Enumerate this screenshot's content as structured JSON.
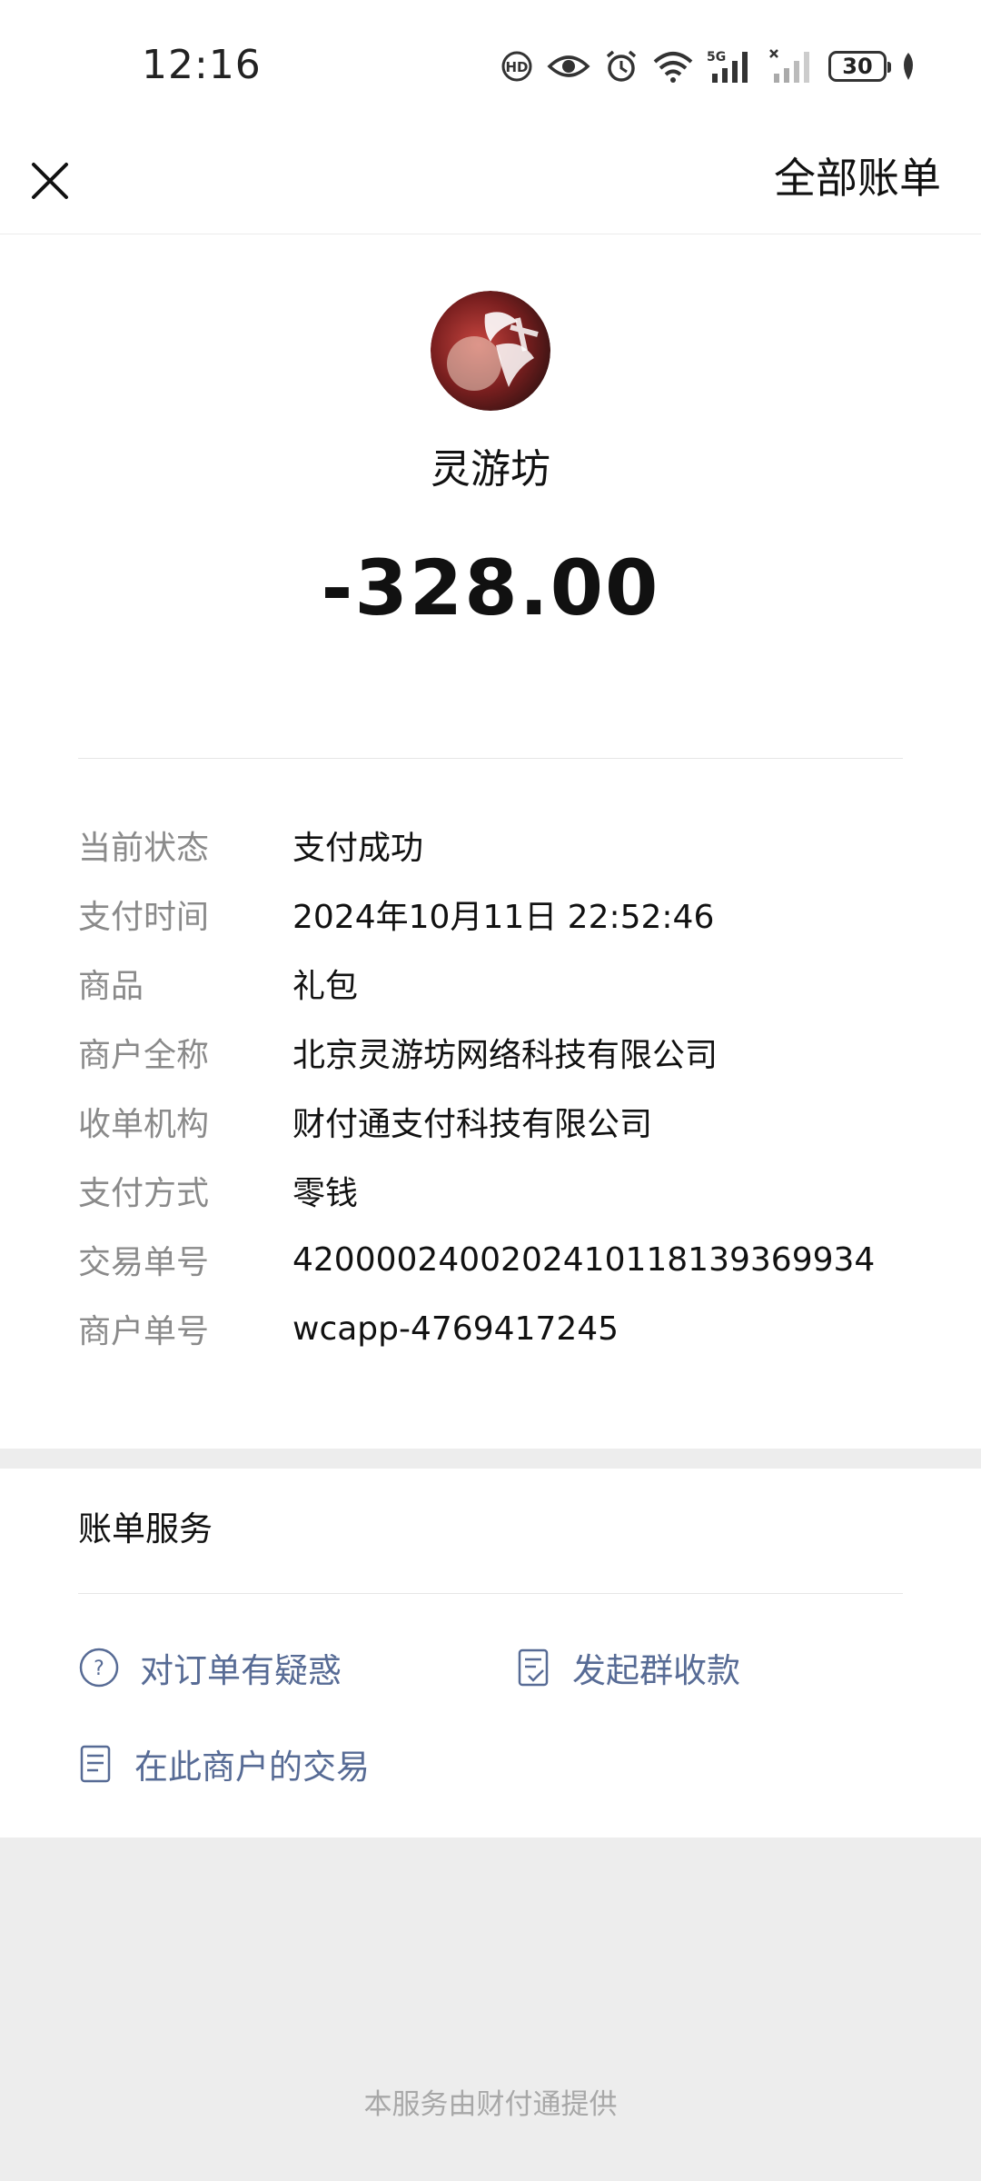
{
  "status_bar": {
    "time": "12:16",
    "network_label": "5G",
    "battery_level": "30",
    "icons": [
      "volte-icon",
      "eye-comfort-icon",
      "alarm-icon",
      "wifi-icon",
      "signal-5g-icon",
      "signal-no-sim-icon",
      "battery-icon",
      "leaf-icon"
    ]
  },
  "nav": {
    "close_icon": "close-icon",
    "all_bills": "全部账单"
  },
  "merchant": {
    "name": "灵游坊",
    "avatar_icon": "merchant-avatar"
  },
  "transaction": {
    "amount": "-328.00",
    "details": [
      {
        "label": "当前状态",
        "value": "支付成功"
      },
      {
        "label": "支付时间",
        "value": "2024年10月11日 22:52:46"
      },
      {
        "label": "商品",
        "value": "礼包"
      },
      {
        "label": "商户全称",
        "value": "北京灵游坊网络科技有限公司"
      },
      {
        "label": "收单机构",
        "value": "财付通支付科技有限公司"
      },
      {
        "label": "支付方式",
        "value": "零钱"
      },
      {
        "label": "交易单号",
        "value": "4200002400202410118139369934"
      },
      {
        "label": "商户单号",
        "value": "wcapp-4769417245"
      }
    ]
  },
  "services": {
    "title": "账单服务",
    "links": [
      {
        "label": "对订单有疑惑",
        "icon": "question-circle-icon"
      },
      {
        "label": "发起群收款",
        "icon": "group-collect-icon"
      },
      {
        "label": "在此商户的交易",
        "icon": "document-icon"
      }
    ]
  },
  "footer": {
    "text": "本服务由财付通提供"
  },
  "colors": {
    "link": "#576b95",
    "label_gray": "#8a8a8a",
    "page_bg": "#ededed"
  }
}
